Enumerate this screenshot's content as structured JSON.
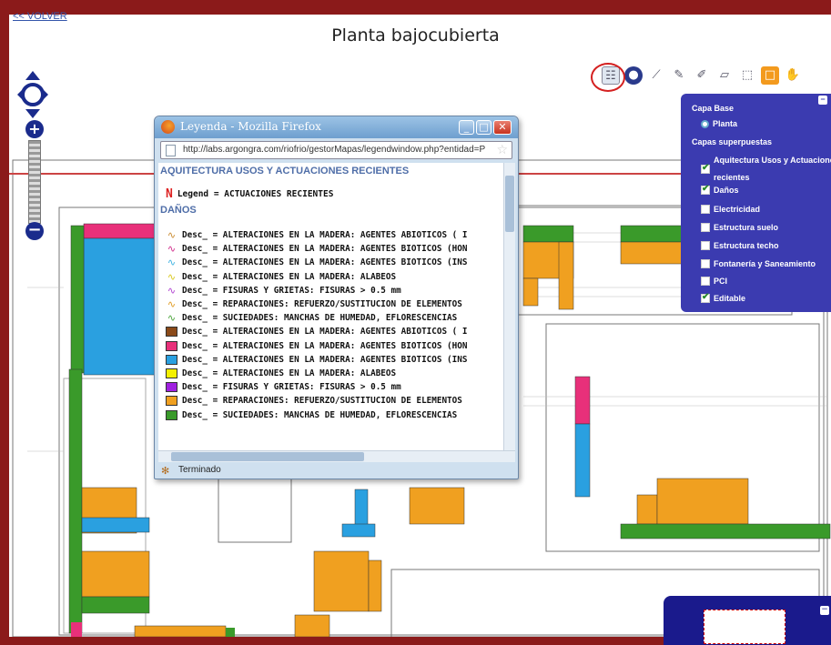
{
  "page": {
    "back_link": "<< VOLVER",
    "title": "Planta bajocubierta"
  },
  "popup": {
    "title": "Leyenda - Mozilla Firefox",
    "url": "http://labs.argongra.com/riofrio/gestorMapas/legendwindow.php?entidad=P",
    "status": "Terminado",
    "sections": {
      "aquitectura": "AQUITECTURA USOS Y ACTUACIONES RECIENTES",
      "legend_main": "Legend = ACTUACIONES RECIENTES",
      "danos": "DAÑOS"
    },
    "legend_items": [
      {
        "type": "line",
        "color": "#c98a2e",
        "label": "Desc_ = ALTERACIONES EN LA MADERA: AGENTES ABIOTICOS ( I"
      },
      {
        "type": "line",
        "color": "#d02a8a",
        "label": "Desc_ = ALTERACIONES EN LA MADERA: AGENTES BIOTICOS (HON"
      },
      {
        "type": "line",
        "color": "#3ab0e0",
        "label": "Desc_ = ALTERACIONES EN LA MADERA: AGENTES BIOTICOS (INS"
      },
      {
        "type": "line",
        "color": "#d8c81a",
        "label": "Desc_ = ALTERACIONES EN LA MADERA: ALABEOS"
      },
      {
        "type": "line",
        "color": "#b040d0",
        "label": "Desc_ = FISURAS Y GRIETAS: FISURAS > 0.5 mm"
      },
      {
        "type": "line",
        "color": "#e09a20",
        "label": "Desc_ = REPARACIONES: REFUERZO/SUSTITUCION DE ELEMENTOS"
      },
      {
        "type": "line",
        "color": "#4aa43a",
        "label": "Desc_ = SUCIEDADES: MANCHAS DE HUMEDAD, EFLORESCENCIAS"
      },
      {
        "type": "fill",
        "color": "#8a4a1a",
        "label": "Desc_ = ALTERACIONES EN LA MADERA: AGENTES ABIOTICOS ( I"
      },
      {
        "type": "fill",
        "color": "#e8307a",
        "label": "Desc_ = ALTERACIONES EN LA MADERA: AGENTES BIOTICOS (HON"
      },
      {
        "type": "fill",
        "color": "#2aa0e0",
        "label": "Desc_ = ALTERACIONES EN LA MADERA: AGENTES BIOTICOS (INS"
      },
      {
        "type": "fill",
        "color": "#f4f000",
        "label": "Desc_ = ALTERACIONES EN LA MADERA: ALABEOS"
      },
      {
        "type": "fill",
        "color": "#a020e0",
        "label": "Desc_ = FISURAS Y GRIETAS: FISURAS > 0.5 mm"
      },
      {
        "type": "fill",
        "color": "#f0a020",
        "label": "Desc_ = REPARACIONES: REFUERZO/SUSTITUCION DE ELEMENTOS"
      },
      {
        "type": "fill",
        "color": "#3a9a2a",
        "label": "Desc_ = SUCIEDADES: MANCHAS DE HUMEDAD, EFLORESCENCIAS"
      }
    ]
  },
  "layers": {
    "base_heading": "Capa Base",
    "base_layer": "Planta",
    "overlays_heading": "Capas superpuestas",
    "overlays": [
      {
        "label": "Aquitectura Usos y Actuaciones recientes",
        "checked": true
      },
      {
        "label": "Daños",
        "checked": true
      },
      {
        "label": "Electricidad",
        "checked": false
      },
      {
        "label": "Estructura suelo",
        "checked": false
      },
      {
        "label": "Estructura techo",
        "checked": false
      },
      {
        "label": "Fontanería y Saneamiento",
        "checked": false
      },
      {
        "label": "PCI",
        "checked": false
      },
      {
        "label": "Editable",
        "checked": true
      }
    ]
  },
  "toolbar": {
    "tools": [
      "legend-icon",
      "globe-icon",
      "measure-icon",
      "draw-line-icon",
      "draw-point-icon",
      "draw-polygon-icon",
      "select-box-icon",
      "zoom-box-icon",
      "pan-hand-icon"
    ]
  },
  "colors": {
    "frame": "#8b1a1a",
    "layers_panel": "#3b3bb0",
    "overview_panel": "#1a1a8c"
  }
}
